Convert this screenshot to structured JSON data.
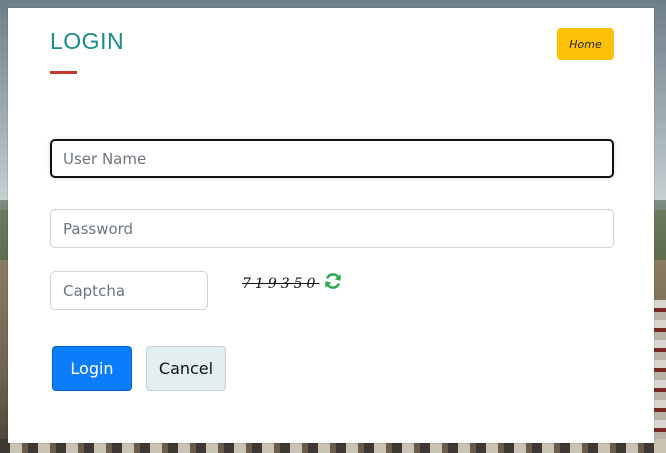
{
  "header": {
    "title": "LOGIN",
    "home_label": "Home"
  },
  "form": {
    "username_placeholder": "User Name",
    "username_value": "",
    "password_placeholder": "Password",
    "password_value": "",
    "captcha_placeholder": "Captcha",
    "captcha_value": "",
    "captcha_code": "719350",
    "refresh_icon": "refresh-icon"
  },
  "actions": {
    "login_label": "Login",
    "cancel_label": "Cancel"
  },
  "colors": {
    "title": "#1a8a8c",
    "underline": "#c0392b",
    "home_button": "#ffc107",
    "login_button": "#0b7dfb",
    "cancel_button": "#e2eef0",
    "refresh_icon": "#2fa84f"
  }
}
